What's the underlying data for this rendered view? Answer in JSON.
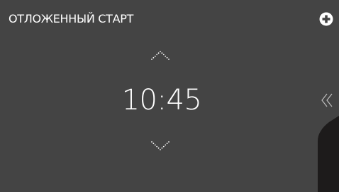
{
  "header": {
    "title": "ОТЛОЖЕННЫЙ СТАРТ"
  },
  "timer": {
    "value": "10:45"
  },
  "icons": {
    "add": "plus-circle-icon",
    "increase": "chevron-up-icon",
    "decrease": "chevron-down-icon",
    "collapse": "double-chevron-left-icon"
  },
  "colors": {
    "background": "#444444",
    "text": "#ffffff",
    "side_panel": "#1d1b1b"
  }
}
